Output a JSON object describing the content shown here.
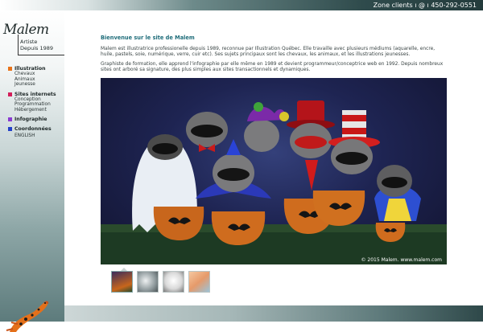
{
  "header": {
    "contact": "Zone clients ı @ ı 450-292-0551"
  },
  "logo": {
    "name": "Malem",
    "line1": "Artiste",
    "line2": "Depuis 1989"
  },
  "nav": [
    {
      "title": "Illustration",
      "color": "#e8731a",
      "items": [
        "Chevaux",
        "Animaux",
        "Jeunesse"
      ]
    },
    {
      "title": "Sites internets",
      "color": "#d21f5a",
      "items": [
        "Conception",
        "Programmation",
        "Hébergement"
      ]
    },
    {
      "title": "Infographie",
      "color": "#8a3bd1",
      "items": []
    },
    {
      "title": "Coordonnées",
      "color": "#2340c8",
      "items": []
    }
  ],
  "nav_english": "ENGLISH",
  "content": {
    "welcome": "Bienvenue sur le site de Malem",
    "p1": "Malem est illustratrice professionelle depuis 1989, reconnue par Illustration Québec. Elle travaille avec plusieurs médiums (aquarelle, encre, huile, pastels, soie, numérique, verre, cuir etc). Ses sujets principaux sont les chevaux, les animaux, et les illustrations jeunesses.",
    "p2": "Graphiste de formation, elle apprend l'infographie par elle même en 1989 et devient programmeur/conceptrice web en 1992. Depuis nombreux sites ont arboré sa signature, des plus simples aux sites transactionnels et dynamiques.",
    "copyright": "© 2015 Malem. www.malem.com"
  },
  "thumbnails": [
    {
      "name": "raccoons-thumbnail",
      "tone": "#5a3a6a"
    },
    {
      "name": "horse-gray-thumbnail",
      "tone": "#9aa3a6"
    },
    {
      "name": "horse-sketch-thumbnail",
      "tone": "#e6e6e6"
    },
    {
      "name": "kids-thumbnail",
      "tone": "#e6a27a"
    }
  ]
}
